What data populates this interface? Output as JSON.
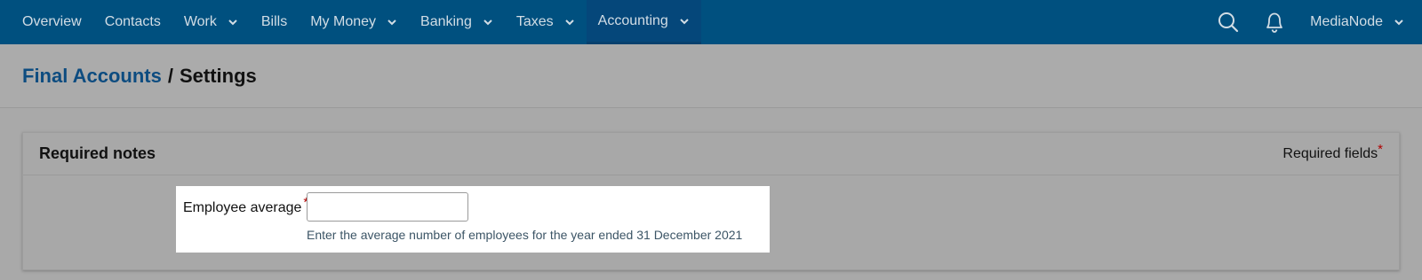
{
  "nav": {
    "items": [
      {
        "label": "Overview",
        "has_chevron": false,
        "active": false
      },
      {
        "label": "Contacts",
        "has_chevron": false,
        "active": false
      },
      {
        "label": "Work",
        "has_chevron": true,
        "active": false
      },
      {
        "label": "Bills",
        "has_chevron": false,
        "active": false
      },
      {
        "label": "My Money",
        "has_chevron": true,
        "active": false
      },
      {
        "label": "Banking",
        "has_chevron": true,
        "active": false
      },
      {
        "label": "Taxes",
        "has_chevron": true,
        "active": false
      },
      {
        "label": "Accounting",
        "has_chevron": true,
        "active": true
      }
    ],
    "search_icon": "search-icon",
    "notifications_icon": "bell-icon",
    "user_label": "MediaNode"
  },
  "breadcrumb": {
    "parent": "Final Accounts",
    "separator": "/",
    "current": "Settings"
  },
  "panel": {
    "title": "Required notes",
    "required_fields_label": "Required fields",
    "required_marker": "*",
    "field": {
      "label": "Employee average",
      "value": "",
      "help": "Enter the average number of employees for the year ended 31 December 2021"
    }
  },
  "colors": {
    "nav_bg": "#00507f",
    "link": "#0d4c80",
    "required_star": "#b00000"
  }
}
